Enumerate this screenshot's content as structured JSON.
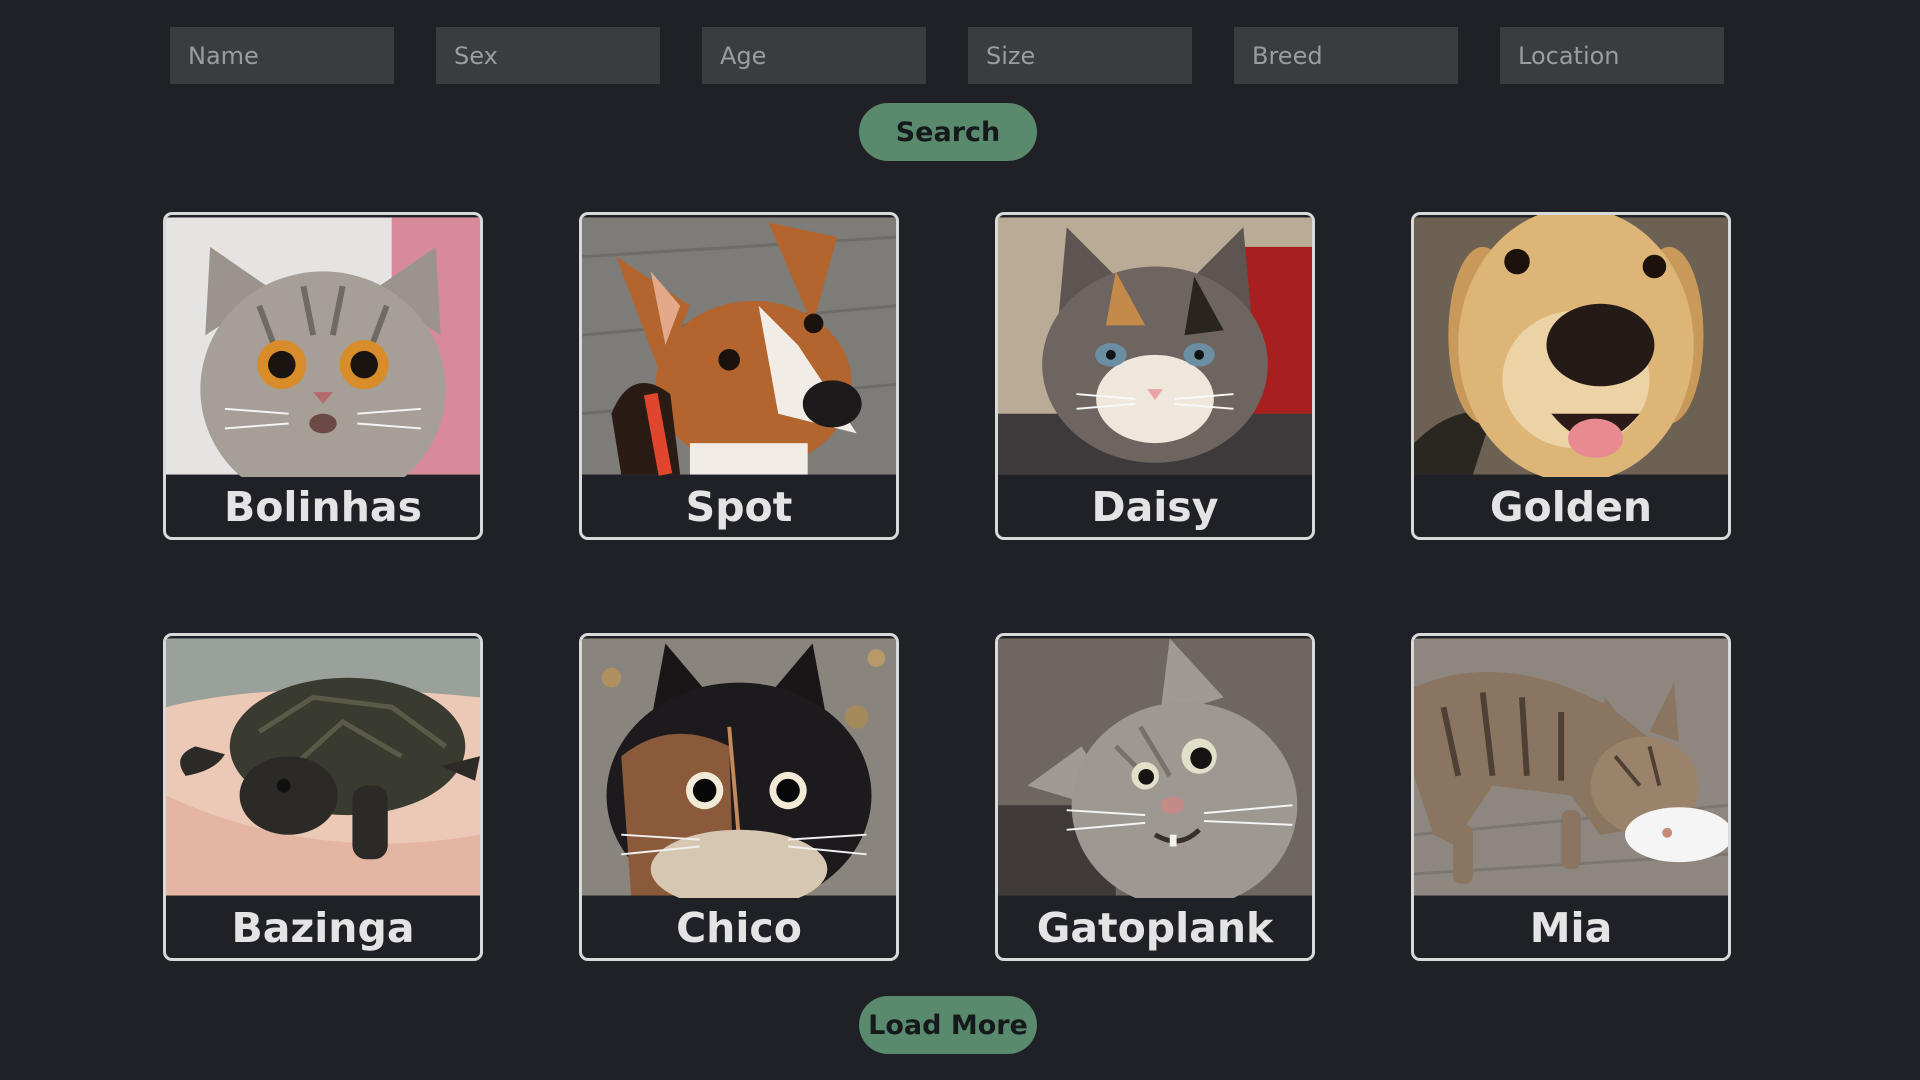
{
  "filters": {
    "name_placeholder": "Name",
    "sex_placeholder": "Sex",
    "age_placeholder": "Age",
    "size_placeholder": "Size",
    "breed_placeholder": "Breed",
    "location_placeholder": "Location"
  },
  "search_label": "Search",
  "load_more_label": "Load More",
  "colors": {
    "background": "#1f2126",
    "input_bg": "#3a3c40",
    "button_green": "#5a8a6e",
    "card_border": "#d9d9d9"
  },
  "pets": [
    {
      "name": "Bolinhas",
      "photo": "surprised-tabby-cat-photo"
    },
    {
      "name": "Spot",
      "photo": "brown-white-dog-photo"
    },
    {
      "name": "Daisy",
      "photo": "calico-kitten-photo"
    },
    {
      "name": "Golden",
      "photo": "golden-retriever-photo"
    },
    {
      "name": "Bazinga",
      "photo": "turtle-in-hand-photo"
    },
    {
      "name": "Chico",
      "photo": "black-orange-cat-photo"
    },
    {
      "name": "Gatoplank",
      "photo": "grey-cat-photo"
    },
    {
      "name": "Mia",
      "photo": "tabby-cat-eating-photo"
    }
  ]
}
